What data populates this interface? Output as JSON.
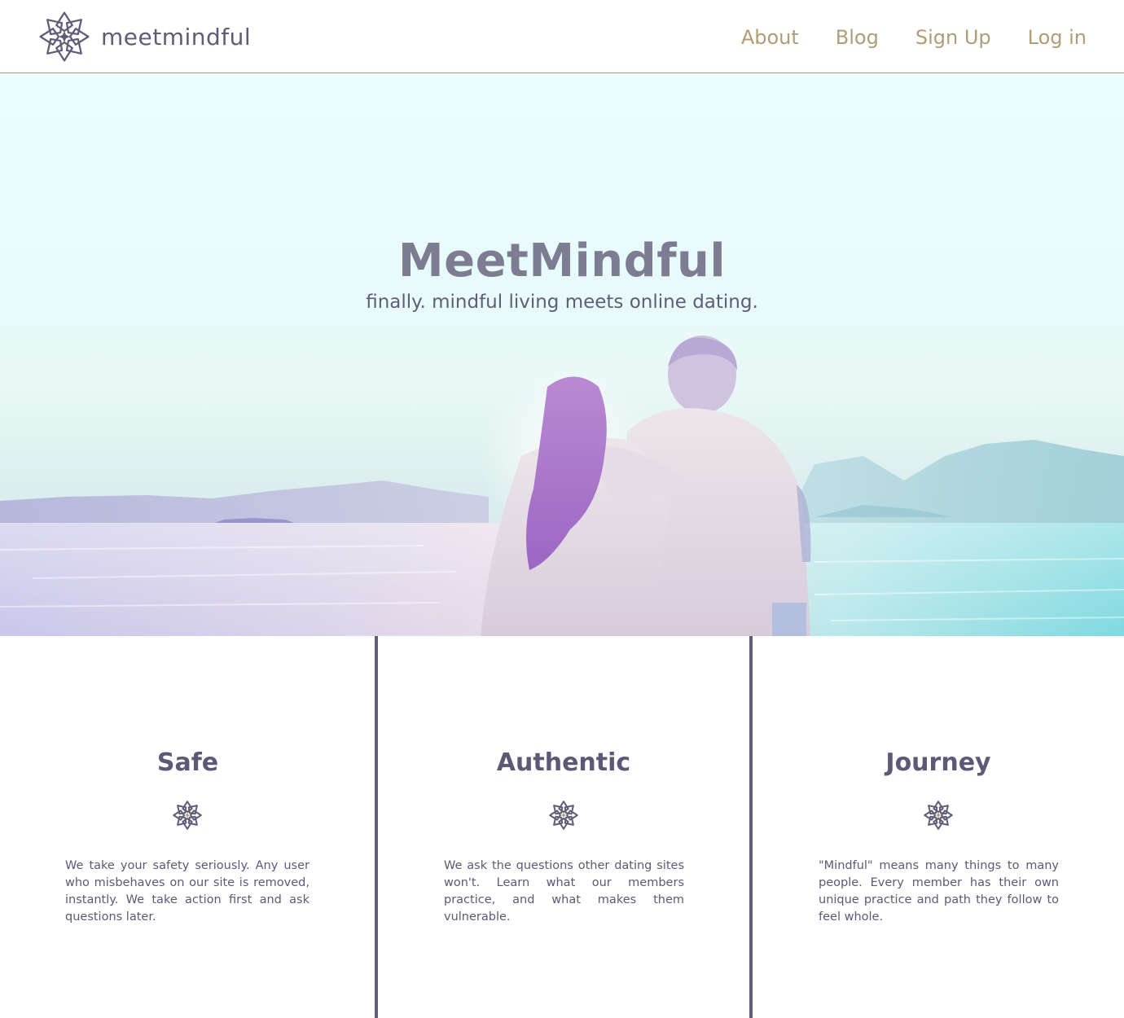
{
  "header": {
    "brand_name": "meetmindful",
    "logo_icon": "lotus-star-logo-icon",
    "nav": [
      {
        "label": "About"
      },
      {
        "label": "Blog"
      },
      {
        "label": "Sign Up"
      },
      {
        "label": "Log in"
      }
    ]
  },
  "hero": {
    "title": "MeetMindful",
    "tagline": "finally. mindful living meets online dating."
  },
  "features": [
    {
      "title": "Safe",
      "icon": "lotus-star-icon",
      "text": "We take your safety seriously. Any user who misbehaves on our site is removed, instantly. We take action first and ask questions later."
    },
    {
      "title": "Authentic",
      "icon": "lotus-star-icon",
      "text": "We ask the questions other dating sites won't. Learn what our members practice, and what makes them vulnerable."
    },
    {
      "title": "Journey",
      "icon": "lotus-star-icon",
      "text": "\"Mindful\" means many things to many people. Every member has their own unique practice and path they follow to feel whole."
    }
  ],
  "colors": {
    "brand_text": "#5f5c77",
    "nav_text": "#b09c77",
    "divider": "#605c79",
    "icon_accent": "#b09c77"
  }
}
